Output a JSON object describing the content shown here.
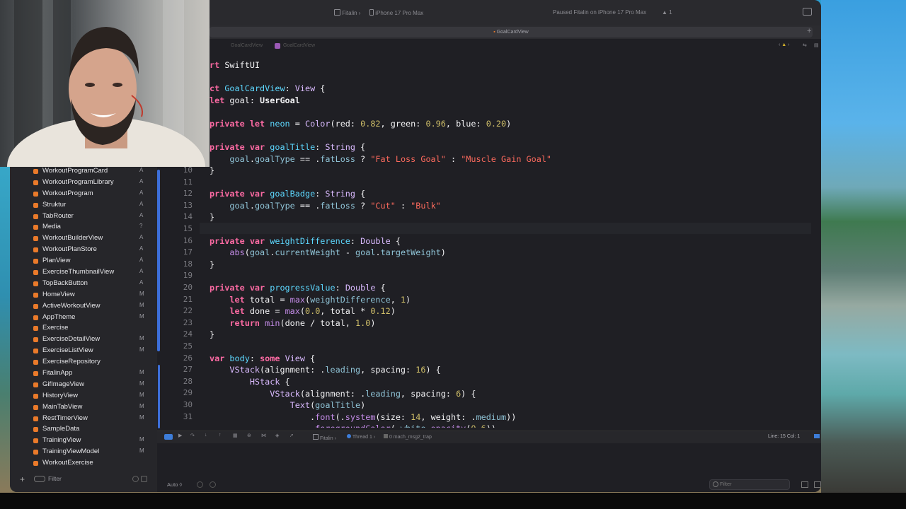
{
  "toolbar": {
    "scheme": "Fitalin",
    "device": "iPhone 17 Pro Max",
    "status": "Paused Fitalin on iPhone 17 Pro Max",
    "warning_count": "1"
  },
  "tab": {
    "title": "GoalCardView"
  },
  "pathbar": {
    "crumb1": "GoalCardView",
    "crumb2": "GoalCardView"
  },
  "sidebar": {
    "items": [
      {
        "label": "WorkoutProgramCard",
        "badge": "A"
      },
      {
        "label": "WorkoutProgramLibrary",
        "badge": "A"
      },
      {
        "label": "WorkoutProgram",
        "badge": "A"
      },
      {
        "label": "Struktur",
        "badge": "A"
      },
      {
        "label": "TabRouter",
        "badge": "A"
      },
      {
        "label": "Media",
        "badge": "?"
      },
      {
        "label": "WorkoutBuilderView",
        "badge": "A"
      },
      {
        "label": "WorkoutPlanStore",
        "badge": "A"
      },
      {
        "label": "PlanView",
        "badge": "A"
      },
      {
        "label": "ExerciseThumbnailView",
        "badge": "A"
      },
      {
        "label": "TopBackButton",
        "badge": "A"
      },
      {
        "label": "HomeView",
        "badge": "M"
      },
      {
        "label": "ActiveWorkoutView",
        "badge": "M"
      },
      {
        "label": "AppTheme",
        "badge": "M"
      },
      {
        "label": "Exercise",
        "badge": ""
      },
      {
        "label": "ExerciseDetailView",
        "badge": "M"
      },
      {
        "label": "ExerciseListView",
        "badge": "M"
      },
      {
        "label": "ExerciseRepository",
        "badge": ""
      },
      {
        "label": "FitalinApp",
        "badge": "M"
      },
      {
        "label": "GifImageView",
        "badge": "M"
      },
      {
        "label": "HistoryView",
        "badge": "M"
      },
      {
        "label": "MainTabView",
        "badge": "M"
      },
      {
        "label": "RestTimerView",
        "badge": "M"
      },
      {
        "label": "SampleData",
        "badge": ""
      },
      {
        "label": "TrainingView",
        "badge": "M"
      },
      {
        "label": "TrainingViewModel",
        "badge": "M"
      },
      {
        "label": "WorkoutExercise",
        "badge": ""
      }
    ],
    "filter_placeholder": "Filter"
  },
  "editor": {
    "line_numbers": [
      "10",
      "11",
      "12",
      "13",
      "14",
      "15",
      "16",
      "17",
      "18",
      "19",
      "20",
      "21",
      "22",
      "23",
      "24",
      "25",
      "26",
      "27",
      "28",
      "29",
      "30",
      "31"
    ]
  },
  "debug": {
    "scheme": "Fitalin",
    "thread": "Thread 1",
    "frame": "0 mach_msg2_trap",
    "position": "Line: 15  Col: 1"
  },
  "console": {
    "mode": "Auto ◊",
    "filter_placeholder": "Filter"
  }
}
